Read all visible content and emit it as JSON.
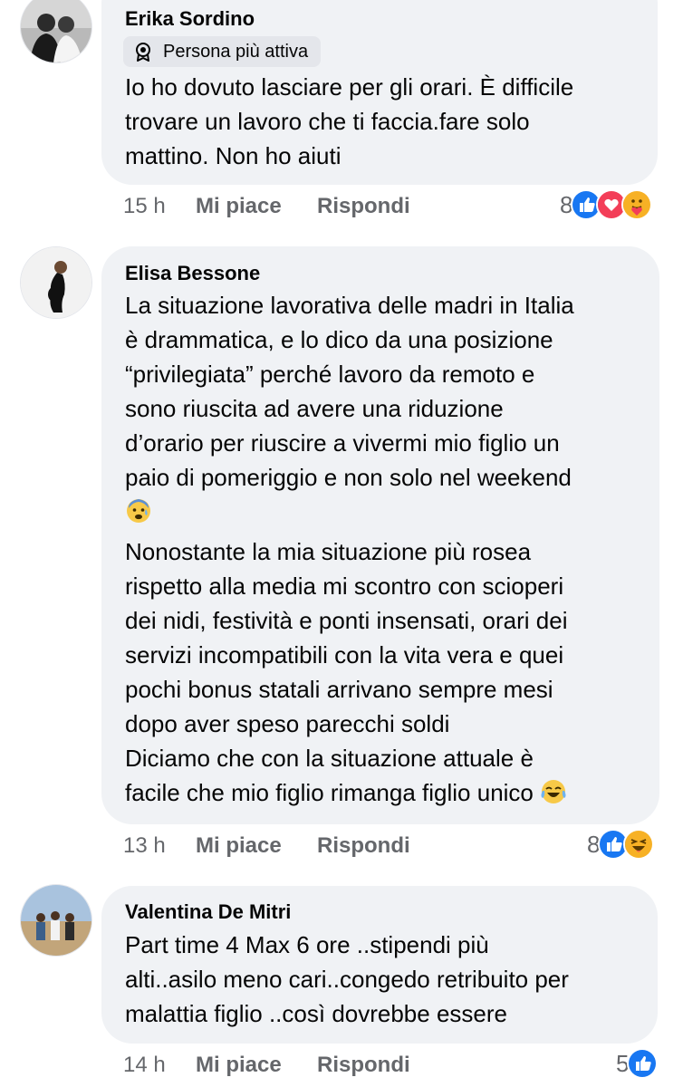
{
  "comments": [
    {
      "author": "Erika Sordino",
      "badge": "Persona più attiva",
      "lines": [
        "Io ho dovuto lasciare per gli orari. È difficile",
        "trovare un lavoro che ti faccia.fare solo",
        "mattino. Non ho aiuti"
      ],
      "time": "15 h",
      "like_label": "Mi piace",
      "reply_label": "Rispondi",
      "reaction_count": "8",
      "reactions": [
        "like-icon",
        "love-icon",
        "care-icon"
      ]
    },
    {
      "author": "Elisa Bessone",
      "lines": [
        "La situazione lavorativa delle madri in Italia",
        "è drammatica, e lo dico da una posizione",
        "“privilegiata” perché lavoro da remoto e",
        "sono riuscita ad avere una riduzione",
        "d’orario per riuscire a vivermi mio figlio un",
        "paio di pomeriggio e non solo nel weekend",
        "",
        "Nonostante la mia situazione più rosea",
        "rispetto alla media mi scontro con scioperi",
        "dei nidi, festività e ponti insensati, orari dei",
        "servizi incompatibili con la vita vera e quei",
        "pochi bonus statali arrivano sempre mesi",
        "dopo aver speso parecchi soldi",
        "Diciamo che con la situazione attuale è",
        "facile che mio figlio rimanga figlio unico"
      ],
      "time": "13 h",
      "like_label": "Mi piace",
      "reply_label": "Rispondi",
      "reaction_count": "8",
      "reactions": [
        "like-icon",
        "haha-icon"
      ]
    },
    {
      "author": "Valentina De Mitri",
      "lines": [
        "Part time 4 Max 6 ore ..stipendi più",
        "alti..asilo meno cari..congedo retribuito per",
        "malattia figlio ..così dovrebbe essere"
      ],
      "time": "14 h",
      "like_label": "Mi piace",
      "reply_label": "Rispondi",
      "reaction_count": "5",
      "reactions": [
        "like-icon"
      ]
    }
  ],
  "colors": {
    "bubble": "#f0f2f5",
    "meta_text": "#65676b",
    "like_blue": "#1877f2",
    "love_red": "#f33e58",
    "emoji_yellow": "#f7b125"
  }
}
